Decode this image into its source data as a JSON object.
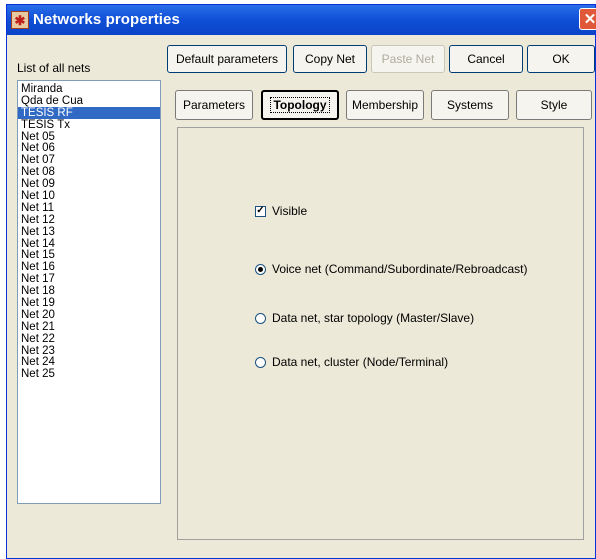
{
  "window": {
    "title": "Networks properties"
  },
  "list": {
    "label": "List of all nets",
    "items": [
      "Miranda",
      "Qda de Cua",
      "TESIS RF",
      "TESIS Tx",
      "Net 05",
      "Net 06",
      "Net 07",
      "Net 08",
      "Net 09",
      "Net 10",
      "Net 11",
      "Net 12",
      "Net 13",
      "Net 14",
      "Net 15",
      "Net 16",
      "Net 17",
      "Net 18",
      "Net 19",
      "Net 20",
      "Net 21",
      "Net 22",
      "Net 23",
      "Net 24",
      "Net 25"
    ],
    "selected": "TESIS RF"
  },
  "toolbar": {
    "default_params": "Default parameters",
    "copy_net": "Copy Net",
    "paste_net": "Paste Net",
    "cancel": "Cancel",
    "ok": "OK"
  },
  "tabs": {
    "parameters": "Parameters",
    "topology": "Topology",
    "membership": "Membership",
    "systems": "Systems",
    "style": "Style",
    "active": "Topology"
  },
  "topology": {
    "visible_label": "Visible",
    "visible_checked": true,
    "options": [
      "Voice net (Command/Subordinate/Rebroadcast)",
      "Data net, star topology (Master/Slave)",
      "Data net, cluster (Node/Terminal)"
    ],
    "selected_option": 0
  }
}
